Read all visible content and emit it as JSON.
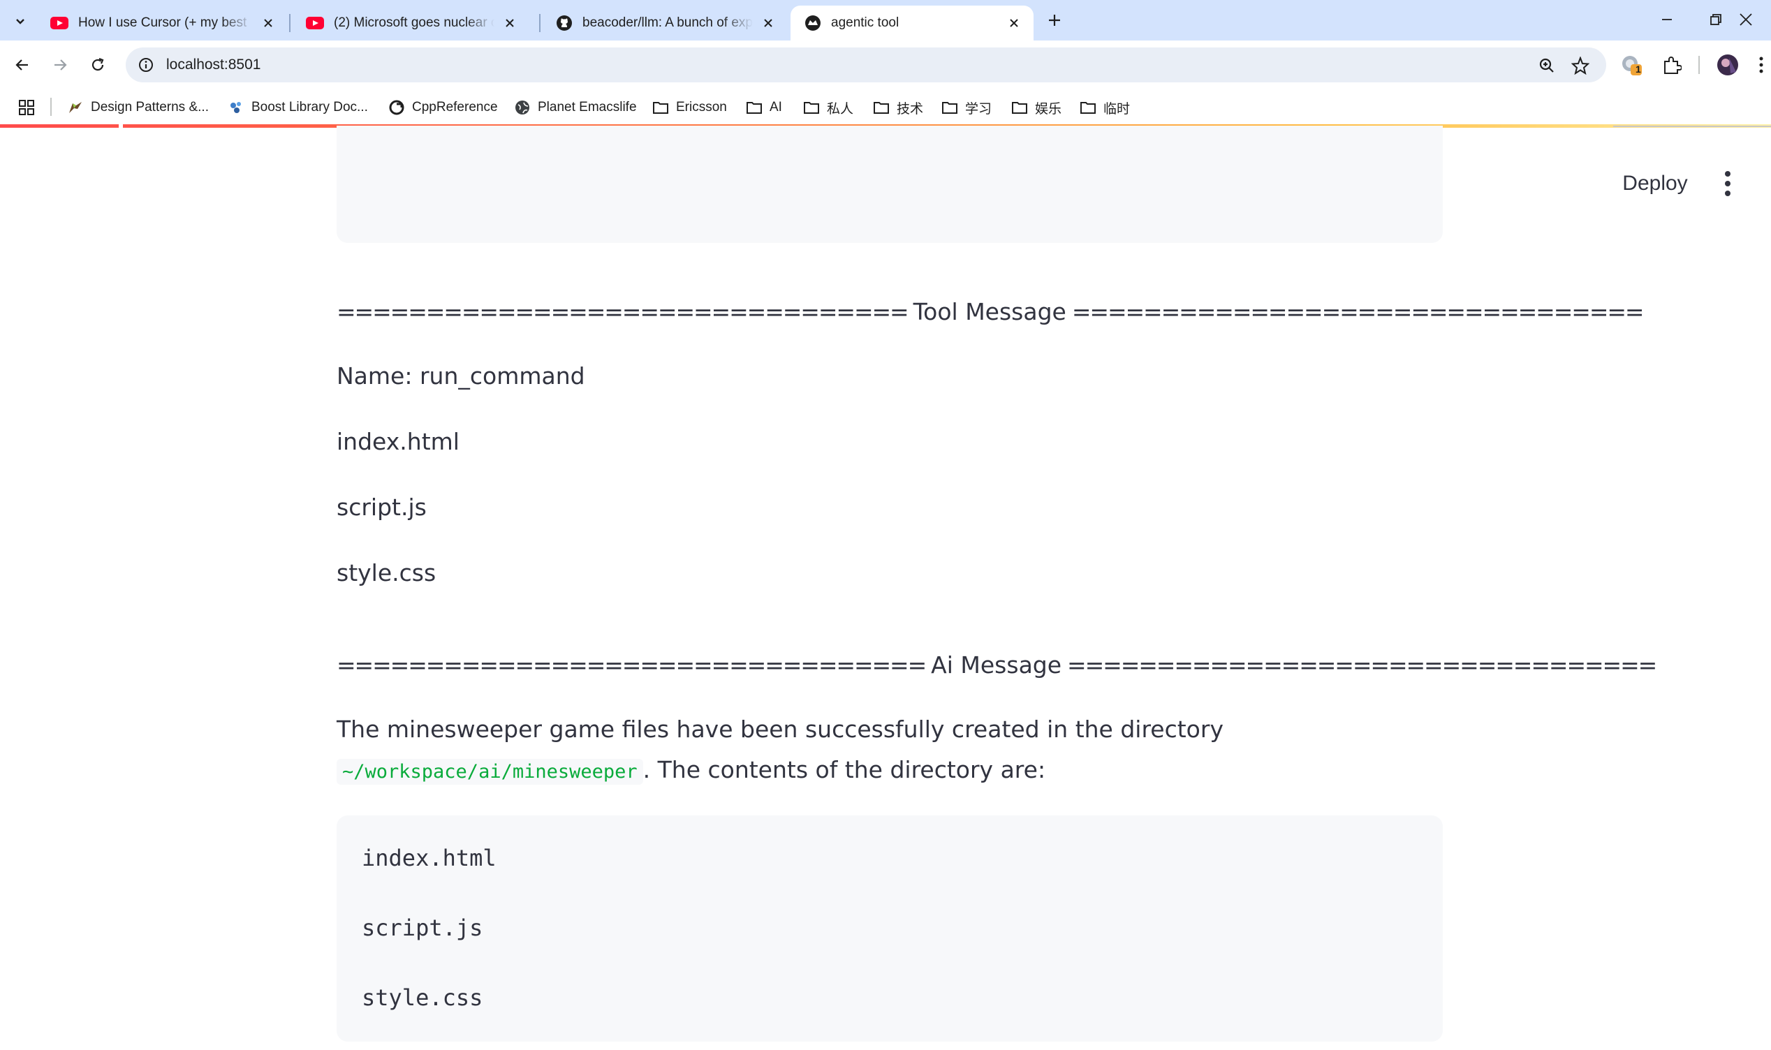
{
  "browser": {
    "tabs": [
      {
        "title": "How I use Cursor (+ my best",
        "icon": "youtube-icon",
        "active": false
      },
      {
        "title": "(2) Microsoft goes nuclear on",
        "icon": "youtube-icon",
        "active": false
      },
      {
        "title": "beacoder/llm: A bunch of exp",
        "icon": "github-icon",
        "active": false
      },
      {
        "title": "agentic tool",
        "icon": "streamlit-icon",
        "active": true
      }
    ],
    "url": "localhost:8501",
    "extension_badge": "1",
    "bookmarks": [
      {
        "label": "Design Patterns &...",
        "icon": "bird-icon"
      },
      {
        "label": "Boost Library Doc...",
        "icon": "boost-icon"
      },
      {
        "label": "CppReference",
        "icon": "cppreference-icon"
      },
      {
        "label": "Planet Emacslife",
        "icon": "globe-icon"
      },
      {
        "label": "Ericsson",
        "icon": "folder-icon"
      },
      {
        "label": "AI",
        "icon": "folder-icon"
      },
      {
        "label": "私人",
        "icon": "folder-icon"
      },
      {
        "label": "技术",
        "icon": "folder-icon"
      },
      {
        "label": "学习",
        "icon": "folder-icon"
      },
      {
        "label": "娱乐",
        "icon": "folder-icon"
      },
      {
        "label": "临时",
        "icon": "folder-icon"
      }
    ]
  },
  "app": {
    "deploy_label": "Deploy",
    "tool_message": {
      "separator": "================================",
      "header": "Tool Message",
      "name_line": "Name: run_command",
      "lines": [
        "index.html",
        "script.js",
        "style.css"
      ]
    },
    "ai_message": {
      "separator": "=================================",
      "header": "Ai Message",
      "text_before": "The minesweeper game files have been successfully created in the directory",
      "path": "~/workspace/ai/minesweeper",
      "text_after": ". The contents of the directory are:",
      "code_lines": [
        "index.html",
        "script.js",
        "style.css"
      ]
    }
  },
  "colors": {
    "tab_strip": "#d3e3fd",
    "omnibox": "#e9eef6",
    "text": "#31333f",
    "inline_code": "#09ab3b",
    "code_bg": "#f7f8fa"
  }
}
